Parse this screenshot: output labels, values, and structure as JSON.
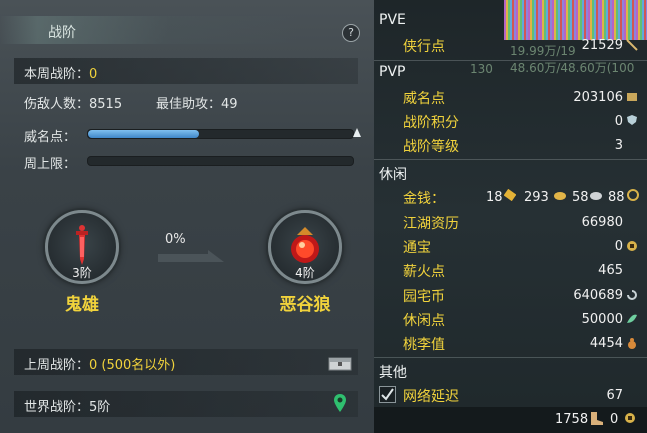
{
  "left_panel": {
    "title": "战阶",
    "help_label": "?",
    "weekly_rank_label": "本周战阶：",
    "weekly_rank_value": "0",
    "kills_label": "伤敌人数：",
    "kills_value": "8515",
    "assists_label": "最佳助攻：",
    "assists_value": "49",
    "renown_label": "威名点：",
    "renown_progress": 0.42,
    "weekly_cap_label": "周上限：",
    "weekly_cap_progress": 0.0,
    "current_rank": {
      "level": "3阶",
      "name": "鬼雄"
    },
    "progress_percent": "0%",
    "next_rank": {
      "level": "4阶",
      "name": "恶谷狼"
    },
    "last_week_label": "上周战阶：",
    "last_week_value": "0 (500名以外)",
    "world_rank_label": "世界战阶：",
    "world_rank_value": "5阶"
  },
  "right_panel": {
    "pve_header": "PVE",
    "pvp_header": "PVP",
    "leisure_header": "休闲",
    "other_header": "其他",
    "pve": [
      {
        "label": "侠行点",
        "value": "21529",
        "icon": "sword-icon"
      }
    ],
    "pvp": [
      {
        "label": "威名点",
        "value": "203106",
        "icon": "badge-icon"
      },
      {
        "label": "战阶积分",
        "value": "0",
        "icon": "shield-icon"
      },
      {
        "label": "战阶等级",
        "value": "3"
      }
    ],
    "money": {
      "label": "金钱：",
      "gold": "18",
      "silver": "293",
      "copper": "58",
      "tael": "88"
    },
    "leisure": [
      {
        "label": "江湖资历",
        "value": "66980"
      },
      {
        "label": "通宝",
        "value": "0",
        "icon": "coin-icon"
      },
      {
        "label": "薪火点",
        "value": "465"
      },
      {
        "label": "园宅币",
        "value": "640689",
        "icon": "swirl-icon"
      },
      {
        "label": "休闲点",
        "value": "50000",
        "icon": "leaf-icon"
      },
      {
        "label": "桃李值",
        "value": "4454",
        "icon": "gourd-icon"
      }
    ],
    "other": [
      {
        "label": "网络延迟",
        "value": "67",
        "checked": true
      }
    ],
    "footer": {
      "left_value": "1758",
      "right_value": "0"
    },
    "background_text": {
      "hp_top": "19.99万/19",
      "hp_bottom": "48.60万/48.60万(100",
      "level": "130"
    }
  },
  "colors": {
    "accent_yellow": "#f1d33c",
    "progress_blue": "#3f86c8",
    "panel_dark": "#1e2629"
  }
}
